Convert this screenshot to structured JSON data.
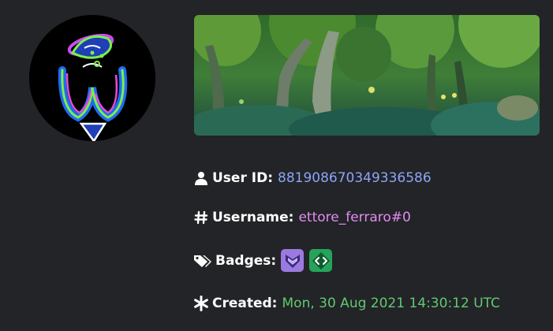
{
  "profile": {
    "avatar_icon": "hand-drawn-neon-character-avatar",
    "banner_icon": "forest-scene-banner"
  },
  "fields": {
    "user_id": {
      "icon": "user-icon",
      "label": "User ID:",
      "value": "881908670349336586",
      "color": "#8ea4f7"
    },
    "username": {
      "icon": "hash-icon",
      "label": "Username:",
      "value": "ettore_ferraro#0",
      "color": "#e38bf2"
    },
    "badges": {
      "icon": "tags-icon",
      "label": "Badges:",
      "items": [
        {
          "icon": "hypesquad-badge-icon",
          "color": "#9b7ae0"
        },
        {
          "icon": "active-developer-badge-icon",
          "color": "#26a35a"
        }
      ]
    },
    "created": {
      "icon": "asterisk-icon",
      "label": "Created:",
      "value": "Mon, 30 Aug 2021 14:30:12 UTC",
      "color": "#63c870"
    }
  }
}
